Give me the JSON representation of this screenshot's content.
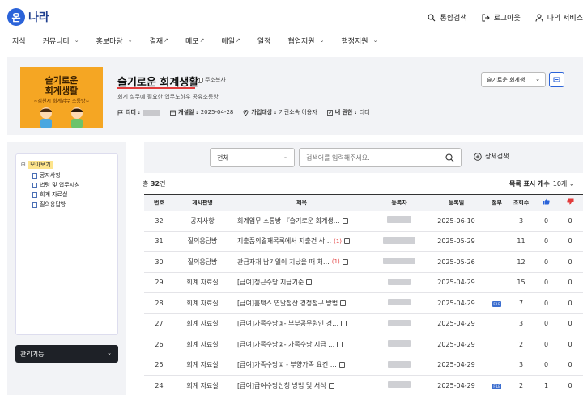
{
  "header": {
    "logo_mark": "온",
    "logo_text": "나라",
    "links": [
      {
        "label": "통합검색",
        "icon": "search-icon"
      },
      {
        "label": "로그아웃",
        "icon": "logout-icon"
      },
      {
        "label": "나의 서비스",
        "icon": "user-icon"
      }
    ]
  },
  "gnb": [
    {
      "label": "지식",
      "suffix": ""
    },
    {
      "label": "커뮤니티",
      "suffix": "⌄"
    },
    {
      "label": "홍보마당",
      "suffix": "⌄"
    },
    {
      "label": "결재",
      "suffix": "↗"
    },
    {
      "label": "메모",
      "suffix": "↗"
    },
    {
      "label": "메일",
      "suffix": "↗"
    },
    {
      "label": "일정",
      "suffix": ""
    },
    {
      "label": "협업지원",
      "suffix": "⌄"
    },
    {
      "label": "행정지원",
      "suffix": "⌄"
    }
  ],
  "club": {
    "thumb_title_1": "슬기로운",
    "thumb_title_2": "회계생활",
    "thumb_sub": "~김천시 회계업무 소통방~",
    "name": "슬기로운 회계생활",
    "copy_label": "주소복사",
    "desc": "회계 실무에 필요한 업무노하우 공유소통방",
    "leader_label": "리더 :",
    "opened_label": "개설일 :",
    "opened_value": "2025-04-28",
    "join_label": "가입대상 :",
    "join_value": "기관소속 이용자",
    "auth_label": "내 권한 :",
    "auth_value": "리더",
    "select_value": "슬기로운 회계생",
    "accent": "#2b63d9"
  },
  "sidebar": {
    "root_label": "모아보기",
    "items": [
      "공지사항",
      "법령 및 업무지침",
      "회계 자료실",
      "질의응답방"
    ],
    "manage_label": "관리기능"
  },
  "search": {
    "scope_value": "전체",
    "keyword_placeholder": "검색어를 입력해주세요.",
    "advanced_label": "상세검색"
  },
  "list": {
    "total_prefix": "총",
    "total_count": "32",
    "total_suffix": "건",
    "per_page_label": "목록 표시 개수",
    "per_page_value": "10개",
    "columns": [
      "번호",
      "게시판명",
      "제목",
      "등록자",
      "등록일",
      "첨부",
      "조회수",
      "like-icon",
      "dislike-icon"
    ],
    "rows": [
      {
        "no": "32",
        "board": "공지사항",
        "title": "회계업무 소통방 『슬기로운 회계생…",
        "comments": "",
        "date": "2025-06-10",
        "attach": false,
        "views": "3",
        "like": "0",
        "dislike": "0"
      },
      {
        "no": "31",
        "board": "질의응답방",
        "title": "지출품의결재목록에서 지출건 삭…",
        "comments": "(1)",
        "date": "2025-05-29",
        "attach": false,
        "views": "11",
        "like": "0",
        "dislike": "0"
      },
      {
        "no": "30",
        "board": "질의응답방",
        "title": "관급자재 납기일이 지났을 때 처…",
        "comments": "(1)",
        "date": "2025-05-26",
        "attach": false,
        "views": "12",
        "like": "0",
        "dislike": "0"
      },
      {
        "no": "29",
        "board": "회계 자료실",
        "title": "[급여]정근수당 지급기준",
        "comments": "",
        "date": "2025-04-29",
        "attach": false,
        "views": "15",
        "like": "0",
        "dislike": "0"
      },
      {
        "no": "28",
        "board": "회계 자료실",
        "title": "[급여]홈택스 연말정산 경정청구 방법",
        "comments": "",
        "date": "2025-04-29",
        "attach": true,
        "views": "7",
        "like": "0",
        "dislike": "0"
      },
      {
        "no": "27",
        "board": "회계 자료실",
        "title": "[급여]가족수당③- 부부공무원인 경…",
        "comments": "",
        "date": "2025-04-29",
        "attach": false,
        "views": "3",
        "like": "0",
        "dislike": "0"
      },
      {
        "no": "26",
        "board": "회계 자료실",
        "title": "[급여]가족수당②- 가족수당 지급 …",
        "comments": "",
        "date": "2025-04-29",
        "attach": false,
        "views": "2",
        "like": "0",
        "dislike": "0"
      },
      {
        "no": "25",
        "board": "회계 자료실",
        "title": "[급여]가족수당① - 부양가족 요건 …",
        "comments": "",
        "date": "2025-04-29",
        "attach": false,
        "views": "3",
        "like": "0",
        "dislike": "0"
      },
      {
        "no": "24",
        "board": "회계 자료실",
        "title": "[급여]급여수당신청 방법 및 서식",
        "comments": "",
        "date": "2025-04-29",
        "attach": true,
        "views": "2",
        "like": "1",
        "dislike": "0"
      }
    ]
  }
}
